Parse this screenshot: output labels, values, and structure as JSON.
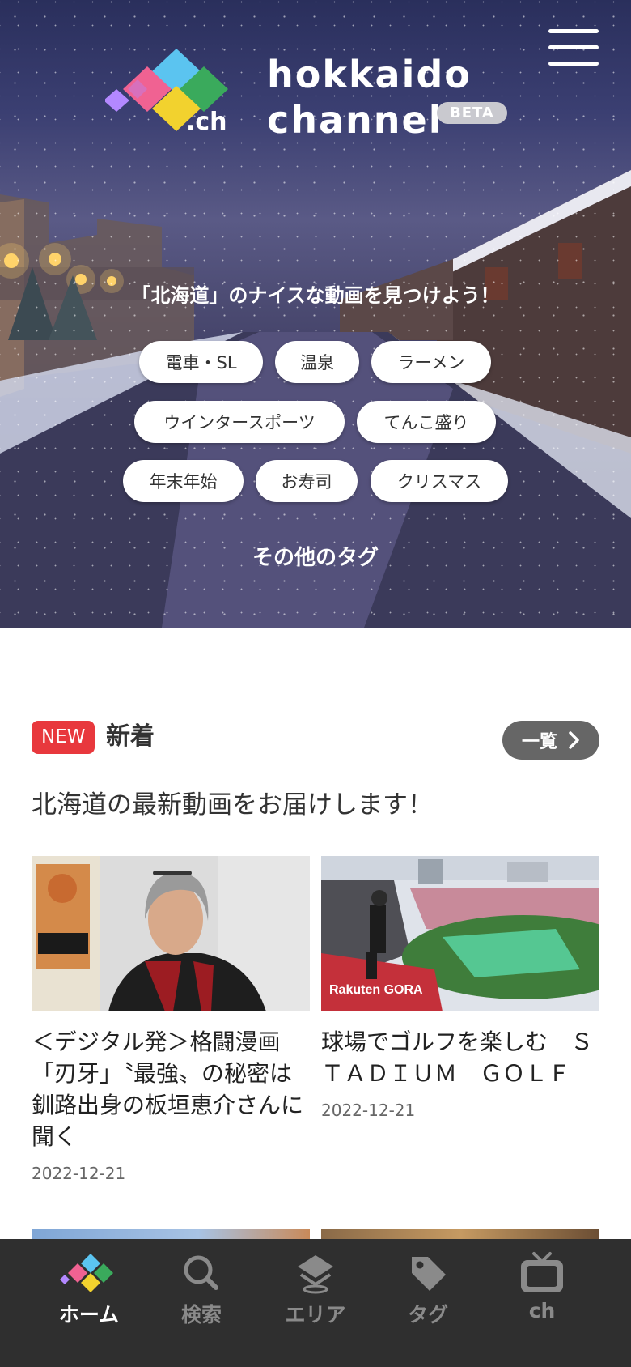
{
  "header": {
    "logo_line1": "hokkaido",
    "logo_line2": "channel",
    "logo_suffix": ".ch",
    "beta_badge": "BETA",
    "menu_icon": "hamburger-menu-icon"
  },
  "hero": {
    "tagline": "「北海道」のナイスな動画を見つけよう！",
    "tags": [
      "電車・SL",
      "温泉",
      "ラーメン",
      "ウインタースポーツ",
      "てんこ盛り",
      "年末年始",
      "お寿司",
      "クリスマス"
    ],
    "more_tags_label": "その他のタグ"
  },
  "new_section": {
    "badge": "NEW",
    "title": "新着",
    "list_button_label": "一覧",
    "subtitle": "北海道の最新動画をお届けします！",
    "videos": [
      {
        "title": "＜デジタル発＞格闘漫画「刃牙」〝最強〟の秘密は釧路出身の板垣恵介さんに聞く",
        "date": "2022-12-21"
      },
      {
        "title": "球場でゴルフを楽しむ　ＳＴＡＤＩＵＭ　ＧＯＬＦ",
        "date": "2022-12-21"
      }
    ]
  },
  "bottom_nav": {
    "items": [
      {
        "label": "ホーム",
        "icon": "home-logo-icon",
        "active": true
      },
      {
        "label": "検索",
        "icon": "search-icon"
      },
      {
        "label": "エリア",
        "icon": "area-map-icon"
      },
      {
        "label": "タグ",
        "icon": "tag-icon"
      },
      {
        "label": "ch",
        "icon": "tv-channel-icon"
      }
    ]
  },
  "colors": {
    "accent_red": "#e8383d",
    "nav_bg": "#2f2f2f",
    "logo_blue": "#5bc4f0",
    "logo_green": "#3aaa5c",
    "logo_pink": "#f06292",
    "logo_yellow": "#f2d22e",
    "logo_purple": "#b388ff"
  }
}
